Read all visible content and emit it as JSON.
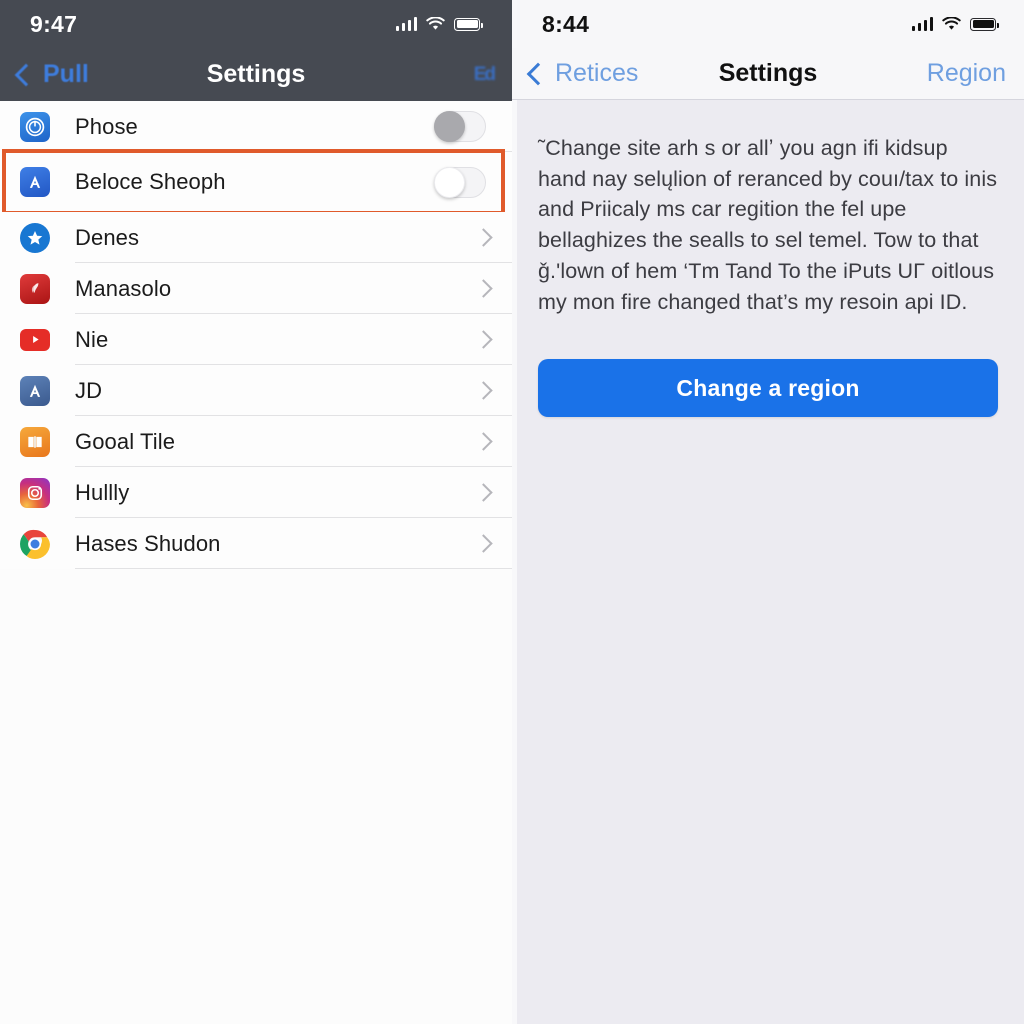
{
  "left_screen": {
    "status_bar": {
      "time": "9:47",
      "icons": [
        "signal-bars-icon",
        "wifi-icon",
        "battery-icon"
      ]
    },
    "nav_bar": {
      "back_label": "Pull",
      "title": "Settings",
      "action_label": "Ed",
      "back_icon": "chevron-left-icon"
    },
    "toggle_rows": [
      {
        "label": "Phose",
        "icon": "safari-app-icon",
        "icon_bg": "#2f7ee0",
        "toggle_state": "off",
        "knob_color": "gray",
        "highlighted": false
      },
      {
        "label": "Beloce Sheoph",
        "icon": "app-store-icon",
        "icon_bg": "#2f6ad6",
        "toggle_state": "off",
        "knob_color": "white",
        "highlighted": true
      }
    ],
    "nav_rows": [
      {
        "label": "Denes",
        "icon": "star-circle-icon",
        "icon_bg": "#1877d2"
      },
      {
        "label": "Manasolo",
        "icon": "music-app-icon",
        "icon_bg": "#c62828"
      },
      {
        "label": "Nie",
        "icon": "youtube-icon",
        "icon_bg": "#e52d27"
      },
      {
        "label": "JD",
        "icon": "app-store-icon",
        "icon_bg": "#4a6fa8"
      },
      {
        "label": "Gooal Tile",
        "icon": "ibooks-icon",
        "icon_bg": "#f0922b"
      },
      {
        "label": "Hullly",
        "icon": "instagram-icon",
        "icon_bg": "#c13584"
      },
      {
        "label": "Hases Shudon",
        "icon": "chrome-icon",
        "icon_bg": "#ffffff"
      }
    ],
    "highlight_color": "#e05a2b",
    "chevron_icon": "chevron-right-icon"
  },
  "right_screen": {
    "status_bar": {
      "time": "8:44",
      "icons": [
        "signal-bars-icon",
        "wifi-icon",
        "battery-icon"
      ]
    },
    "nav_bar": {
      "back_label": "Retices",
      "title": "Settings",
      "action_label": "Region",
      "back_icon": "chevron-left-icon"
    },
    "body": {
      "paragraph": "˜Change site arh s or allʼ you agn ifi kidsup hand nay selųlion of reranced by couı/tax to inis and Priicaly ms car regition the fel upe bellaɡhizes the sealls to sel temel. Tow to that ǧ.'lown of hem ‘Tm Tand To the iPuts UΓ oitlous my mon fire changed that’s my resoin api ID.",
      "button_label": "Change a region",
      "button_color": "#1a72e8"
    }
  }
}
